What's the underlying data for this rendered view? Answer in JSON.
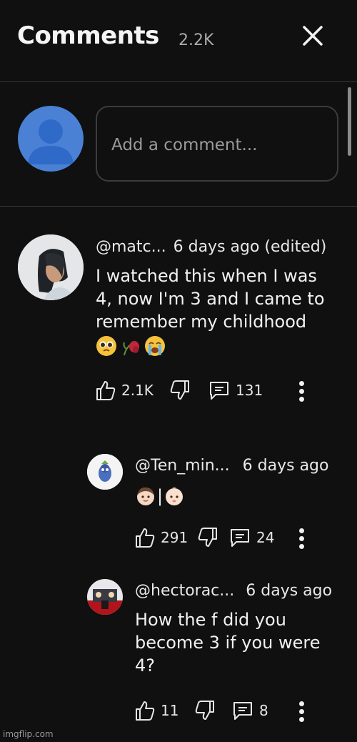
{
  "header": {
    "title": "Comments",
    "count": "2.2K"
  },
  "composer": {
    "placeholder": "Add a comment..."
  },
  "comments": [
    {
      "handle": "@matc...",
      "time": "6 days ago (edited)",
      "text_lines": [
        "I watched this when I was",
        "4, now I'm 3 and I came to",
        "remember my childhood"
      ],
      "emoji_names": [
        "pleading-face-emoji",
        "wilted-flower-emoji",
        "loudly-crying-face-emoji"
      ],
      "likes": "2.1K",
      "replies": "131"
    },
    {
      "handle": "@Ten_min...",
      "time": "6 days ago",
      "text_line": "|",
      "emoji_names": [
        "boy-face-emoji",
        "baby-face-emoji"
      ],
      "likes": "291",
      "replies": "24"
    },
    {
      "handle": "@hectorac...",
      "time": "6 days ago",
      "text_lines": [
        "How the f did you",
        "become 3 if you were",
        "4?"
      ],
      "likes": "11",
      "replies": "8"
    }
  ],
  "icons": [
    "close-icon",
    "avatar-placeholder-icon",
    "like-icon",
    "dislike-icon",
    "reply-icon",
    "more-options-icon"
  ],
  "colors": {
    "background": "#101010",
    "self_avatar": "#4a81d4",
    "text": "#f1f1f1",
    "muted": "#aaaaaa"
  },
  "watermark": "imgflip.com"
}
